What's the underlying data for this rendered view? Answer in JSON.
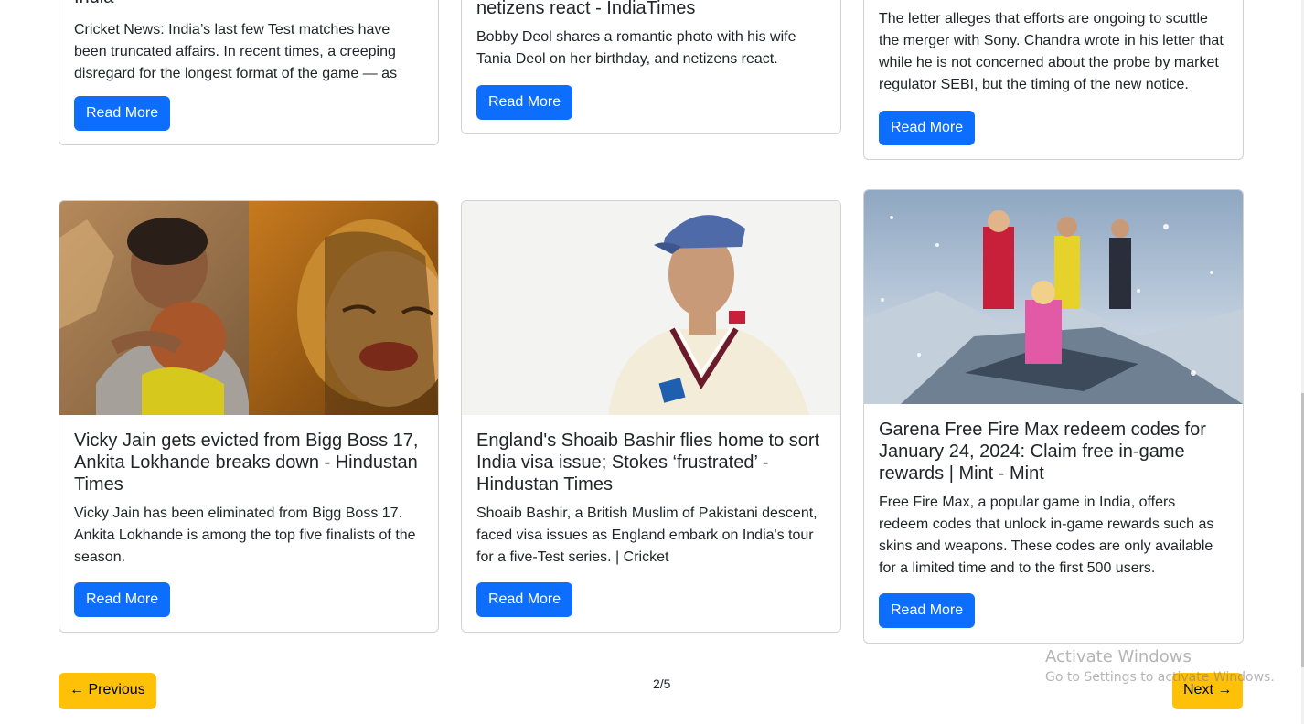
{
  "cards_top": [
    {
      "title": "India",
      "text": "Cricket News: India’s last few Test matches have been truncated affairs. In recent times, a creeping disregard for the longest format of the game — as seen in the s",
      "button": "Read More"
    },
    {
      "title": "netizens react - IndiaTimes",
      "text": "Bobby Deol shares a romantic photo with his wife Tania Deol on her birthday, and netizens react.",
      "button": "Read More"
    },
    {
      "title": "",
      "text": "The letter alleges that efforts are ongoing to scuttle the merger with Sony. Chandra wrote in his letter that while he is not concerned about the probe by market regulator SEBI, but the timing of the new notice.",
      "button": "Read More"
    }
  ],
  "cards_bottom": [
    {
      "title": "Vicky Jain gets evicted from Bigg Boss 17, Ankita Lokhande breaks down - Hindustan Times",
      "text": "Vicky Jain has been eliminated from Bigg Boss 17. Ankita Lokhande is among the top five finalists of the season.",
      "button": "Read More"
    },
    {
      "title": "England's Shoaib Bashir flies home to sort India visa issue; Stokes ‘frustrated’ - Hindustan Times",
      "text": "Shoaib Bashir, a British Muslim of Pakistani descent, faced visa issues as England embark on India's tour for a five-Test series. | Cricket",
      "button": "Read More"
    },
    {
      "title": "Garena Free Fire Max redeem codes for January 24, 2024: Claim free in-game rewards | Mint - Mint",
      "text": "Free Fire Max, a popular game in India, offers redeem codes that unlock in-game rewards such as skins and weapons. These codes are only available for a limited time and to the first 500 users.",
      "button": "Read More"
    }
  ],
  "pagination": {
    "previous": "← Previous",
    "indicator": "2/5",
    "next": "Next →"
  },
  "watermark": {
    "title": "Activate Windows",
    "subtitle": "Go to Settings to activate Windows."
  },
  "colors": {
    "primary_button": "#0d6efd",
    "pager_button": "#ffc107"
  }
}
